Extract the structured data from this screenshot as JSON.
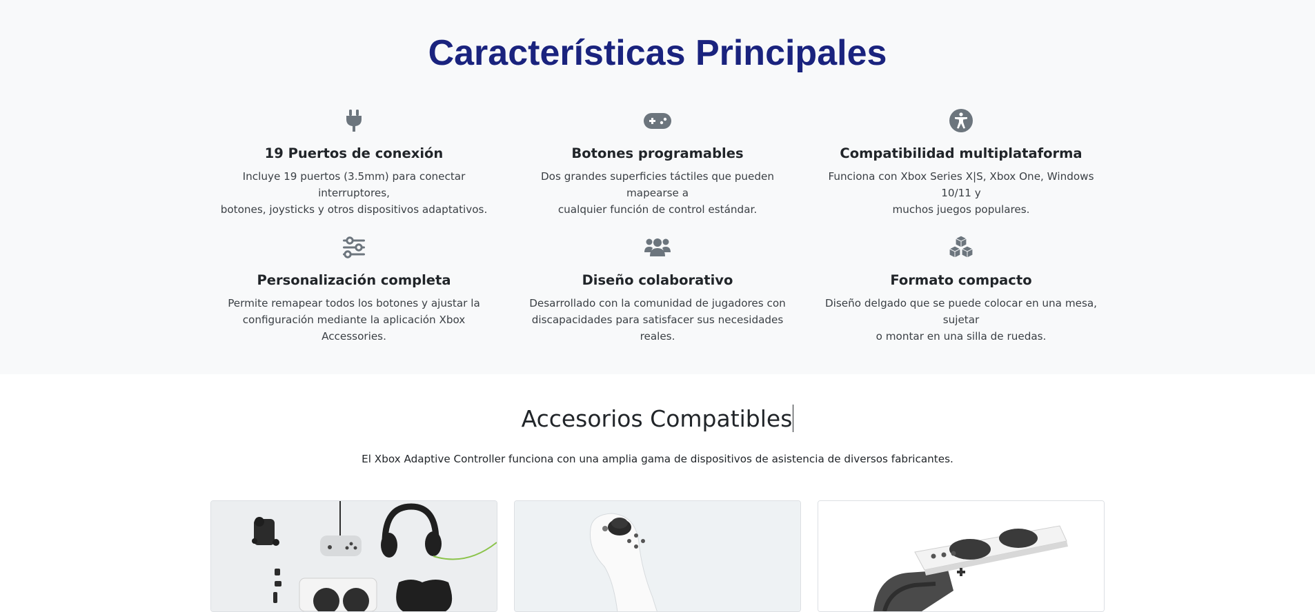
{
  "features_section": {
    "title": "Características Principales",
    "items": [
      {
        "icon": "plug-icon",
        "title": "19 Puertos de conexión",
        "line1": "Incluye 19 puertos (3.5mm) para conectar interruptores,",
        "line2": "botones, joysticks y otros dispositivos adaptativos."
      },
      {
        "icon": "gamepad-icon",
        "title": "Botones programables",
        "line1": "Dos grandes superficies táctiles que pueden mapearse a",
        "line2": "cualquier función de control estándar."
      },
      {
        "icon": "accessibility-icon",
        "title": "Compatibilidad multiplataforma",
        "line1": "Funciona con Xbox Series X|S, Xbox One, Windows 10/11 y",
        "line2": "muchos juegos populares."
      },
      {
        "icon": "sliders-icon",
        "title": "Personalización completa",
        "line1": "Permite remapear todos los botones y ajustar la",
        "line2": "configuración mediante la aplicación Xbox Accessories."
      },
      {
        "icon": "users-icon",
        "title": "Diseño colaborativo",
        "line1": "Desarrollado con la comunidad de jugadores con",
        "line2": "discapacidades para satisfacer sus necesidades reales."
      },
      {
        "icon": "cubes-icon",
        "title": "Formato compacto",
        "line1": "Diseño delgado que se puede colocar en una mesa, sujetar",
        "line2": "o montar en una silla de ruedas."
      }
    ]
  },
  "accessories_section": {
    "title": "Accesorios Compatibles",
    "subtitle": "El Xbox Adaptive Controller funciona con una amplia gama de dispositivos de asistencia de diversos fabricantes."
  },
  "colors": {
    "features_bg": "#f8f9fa",
    "title_blue": "#1a237e",
    "icon_gray": "#6c757d"
  }
}
